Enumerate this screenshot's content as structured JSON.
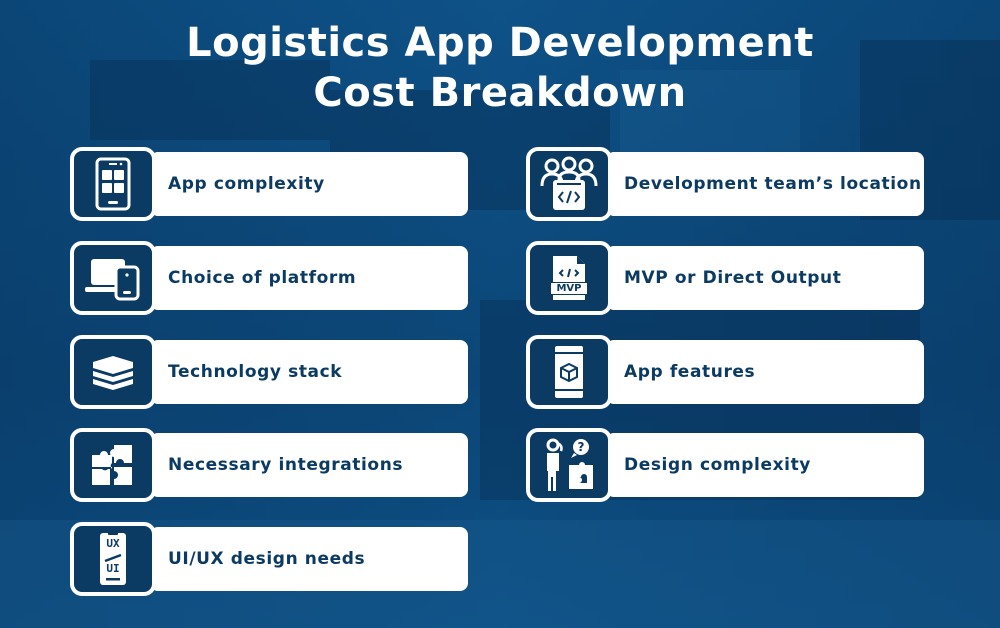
{
  "title": {
    "line1": "Logistics App Development",
    "line2": "Cost Breakdown"
  },
  "colors": {
    "background": "#0c4a7a",
    "card_fill": "#ffffff",
    "icon_tile": "#0b3a63",
    "label_text": "#0b3a63",
    "title_text": "#ffffff"
  },
  "left_column": [
    {
      "label": "App complexity",
      "icon": "smartphone-apps-icon"
    },
    {
      "label": "Choice of platform",
      "icon": "laptop-phone-icon"
    },
    {
      "label": "Technology stack",
      "icon": "layers-stack-icon"
    },
    {
      "label": "Necessary integrations",
      "icon": "puzzle-pieces-icon"
    },
    {
      "label": "UI/UX design needs",
      "icon": "ux-ui-phone-icon"
    }
  ],
  "right_column": [
    {
      "label": "Development team’s location",
      "icon": "team-code-icon"
    },
    {
      "label": "MVP or Direct Output",
      "icon": "mvp-document-icon"
    },
    {
      "label": "App features",
      "icon": "phone-cube-icon"
    },
    {
      "label": "Design complexity",
      "icon": "thinking-person-puzzle-icon"
    }
  ],
  "icon_text": {
    "mvp": "MVP",
    "ux": "UX",
    "ui": "UI",
    "question": "?"
  }
}
